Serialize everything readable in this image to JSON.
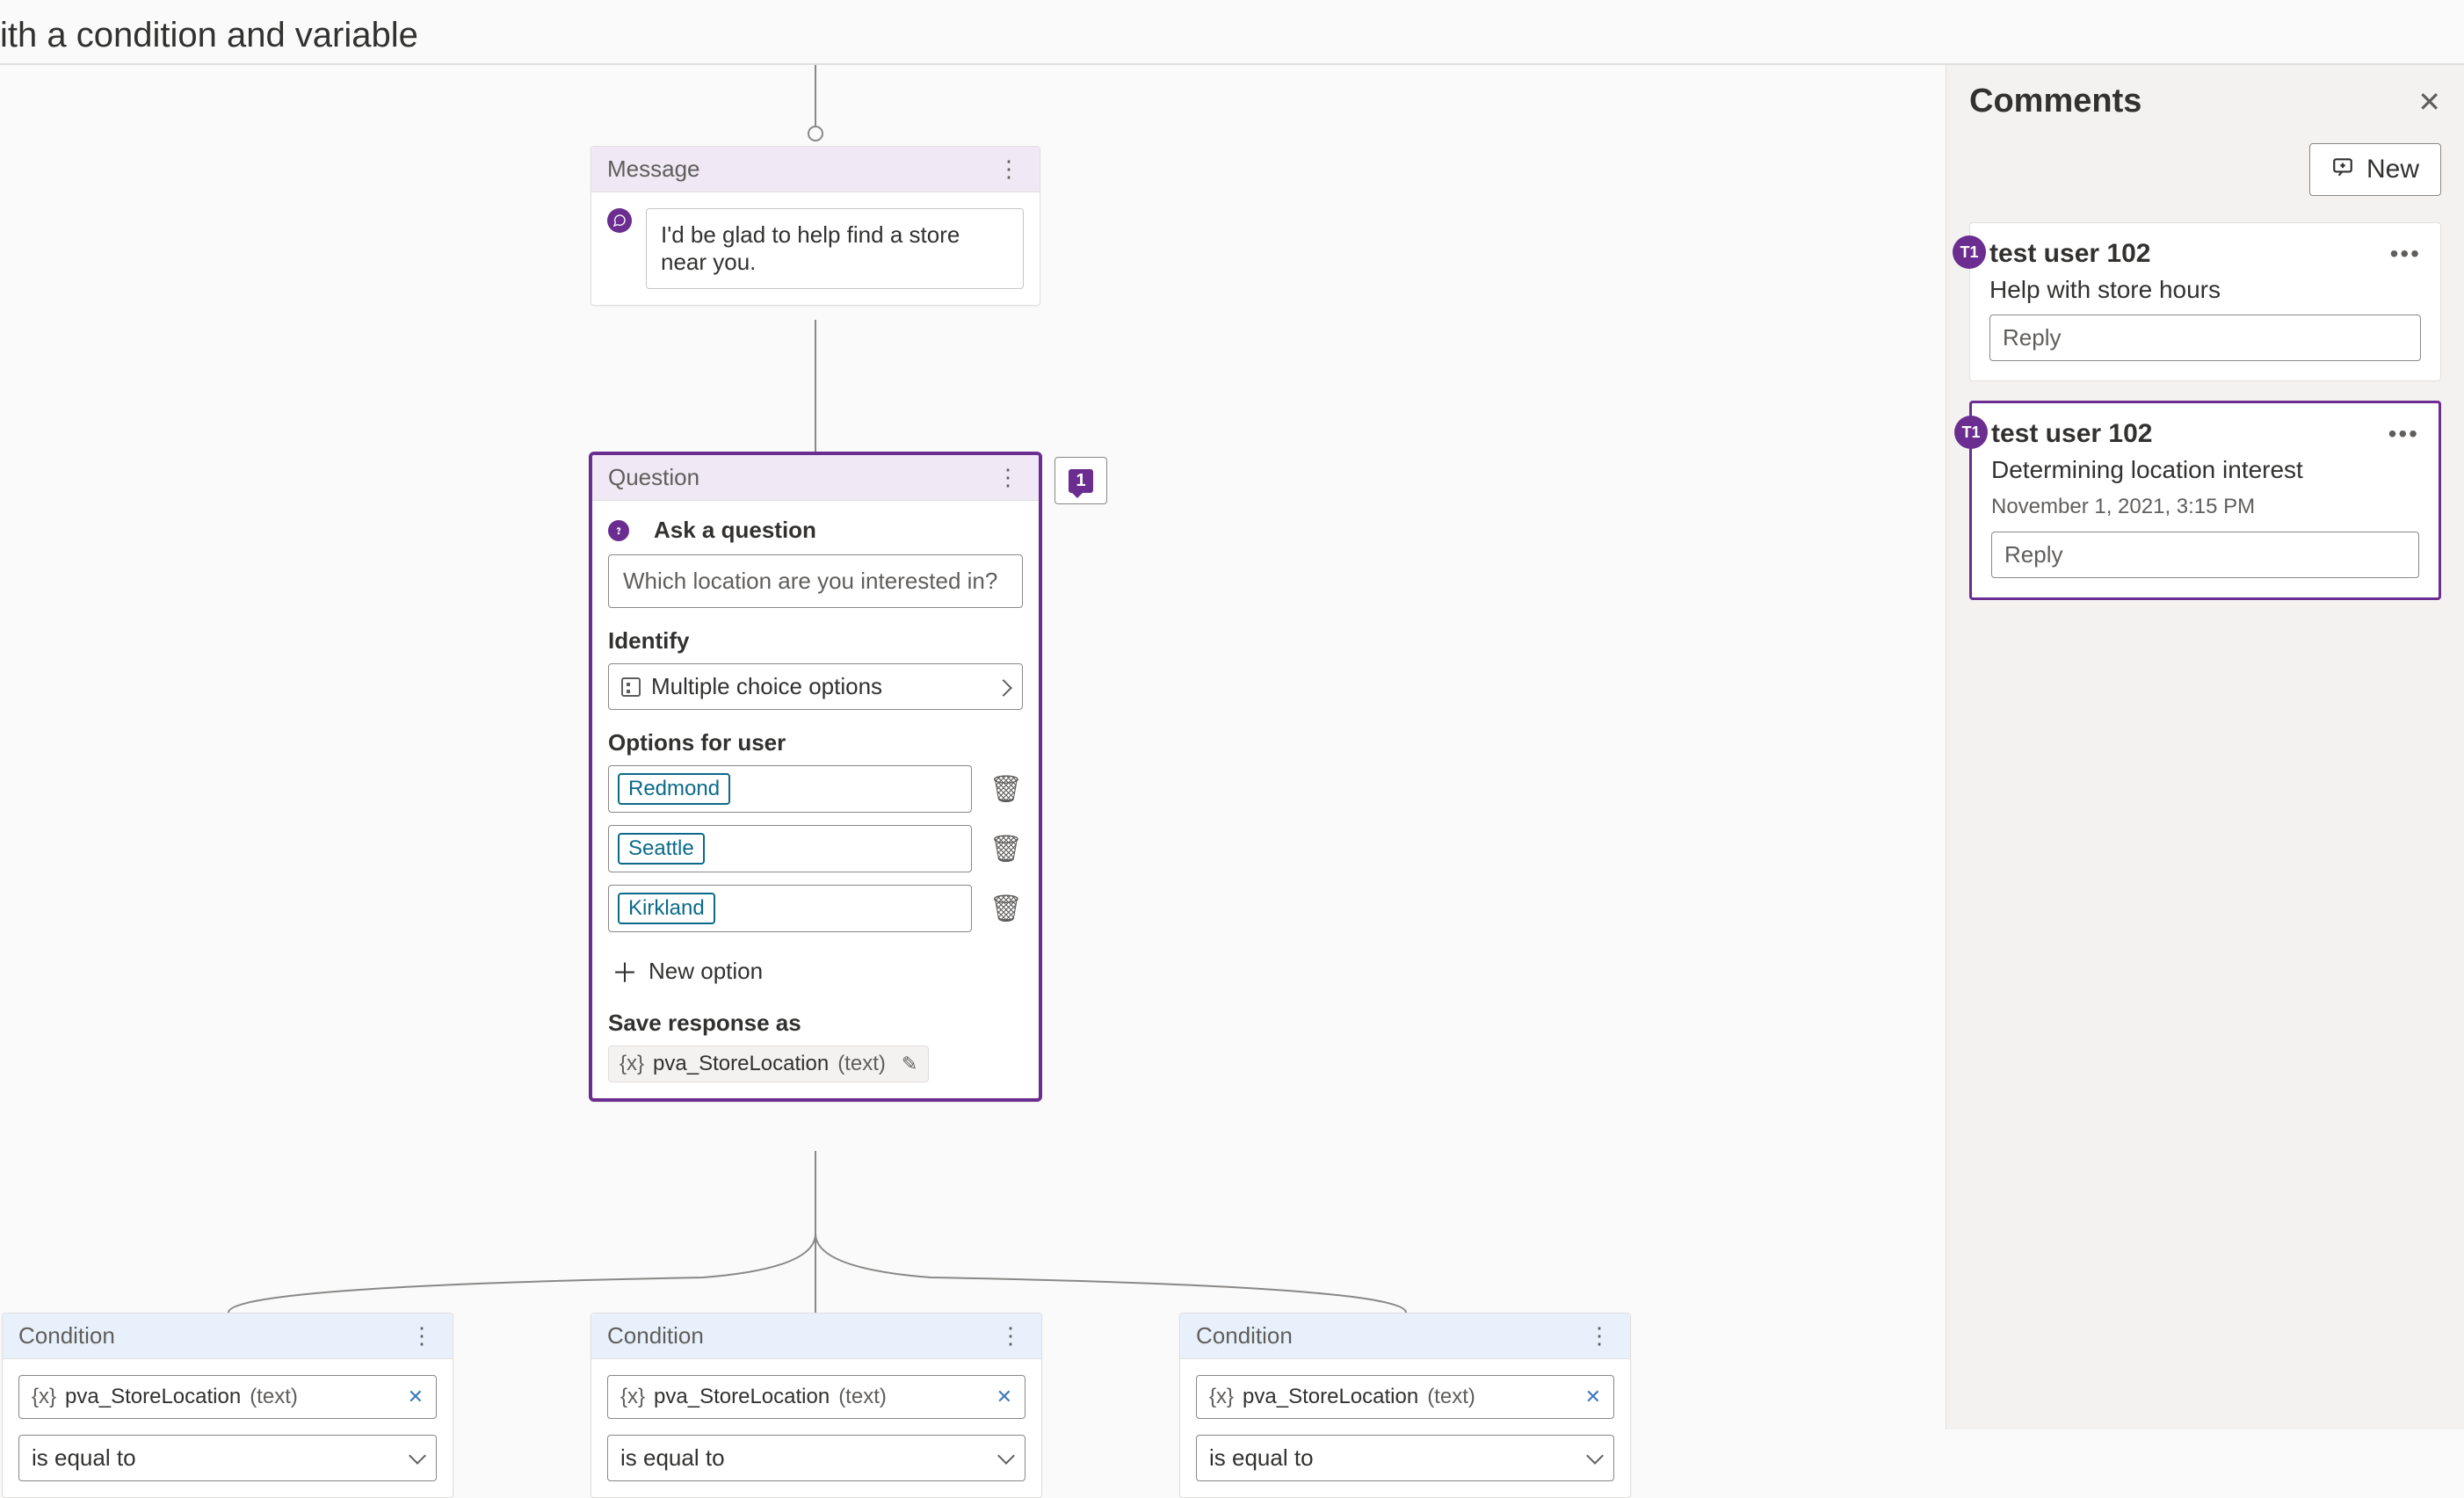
{
  "page_title_fragment": "ith a condition and variable",
  "canvas": {
    "message_node": {
      "header": "Message",
      "text": "I'd be glad to help find a store near you."
    },
    "question_node": {
      "header": "Question",
      "ask_label": "Ask a question",
      "question_text": "Which location are you interested in?",
      "identify_label": "Identify",
      "identify_value": "Multiple choice options",
      "options_label": "Options for user",
      "options": [
        "Redmond",
        "Seattle",
        "Kirkland"
      ],
      "new_option_label": "New option",
      "save_label": "Save response as",
      "variable_name": "pva_StoreLocation",
      "variable_type": "(text)",
      "comment_badge_count": "1"
    },
    "conditions": [
      {
        "header": "Condition",
        "variable_name": "pva_StoreLocation",
        "variable_type": "(text)",
        "operator": "is equal to"
      },
      {
        "header": "Condition",
        "variable_name": "pva_StoreLocation",
        "variable_type": "(text)",
        "operator": "is equal to"
      },
      {
        "header": "Condition",
        "variable_name": "pva_StoreLocation",
        "variable_type": "(text)",
        "operator": "is equal to"
      }
    ]
  },
  "comments_panel": {
    "title": "Comments",
    "new_label": "New",
    "reply_placeholder": "Reply",
    "items": [
      {
        "avatar_initials": "T1",
        "user": "test user 102",
        "body": "Help with store hours",
        "timestamp": "",
        "selected": false
      },
      {
        "avatar_initials": "T1",
        "user": "test user 102",
        "body": "Determining location interest",
        "timestamp": "November 1, 2021, 3:15 PM",
        "selected": true
      }
    ]
  },
  "var_glyph": "{x}"
}
